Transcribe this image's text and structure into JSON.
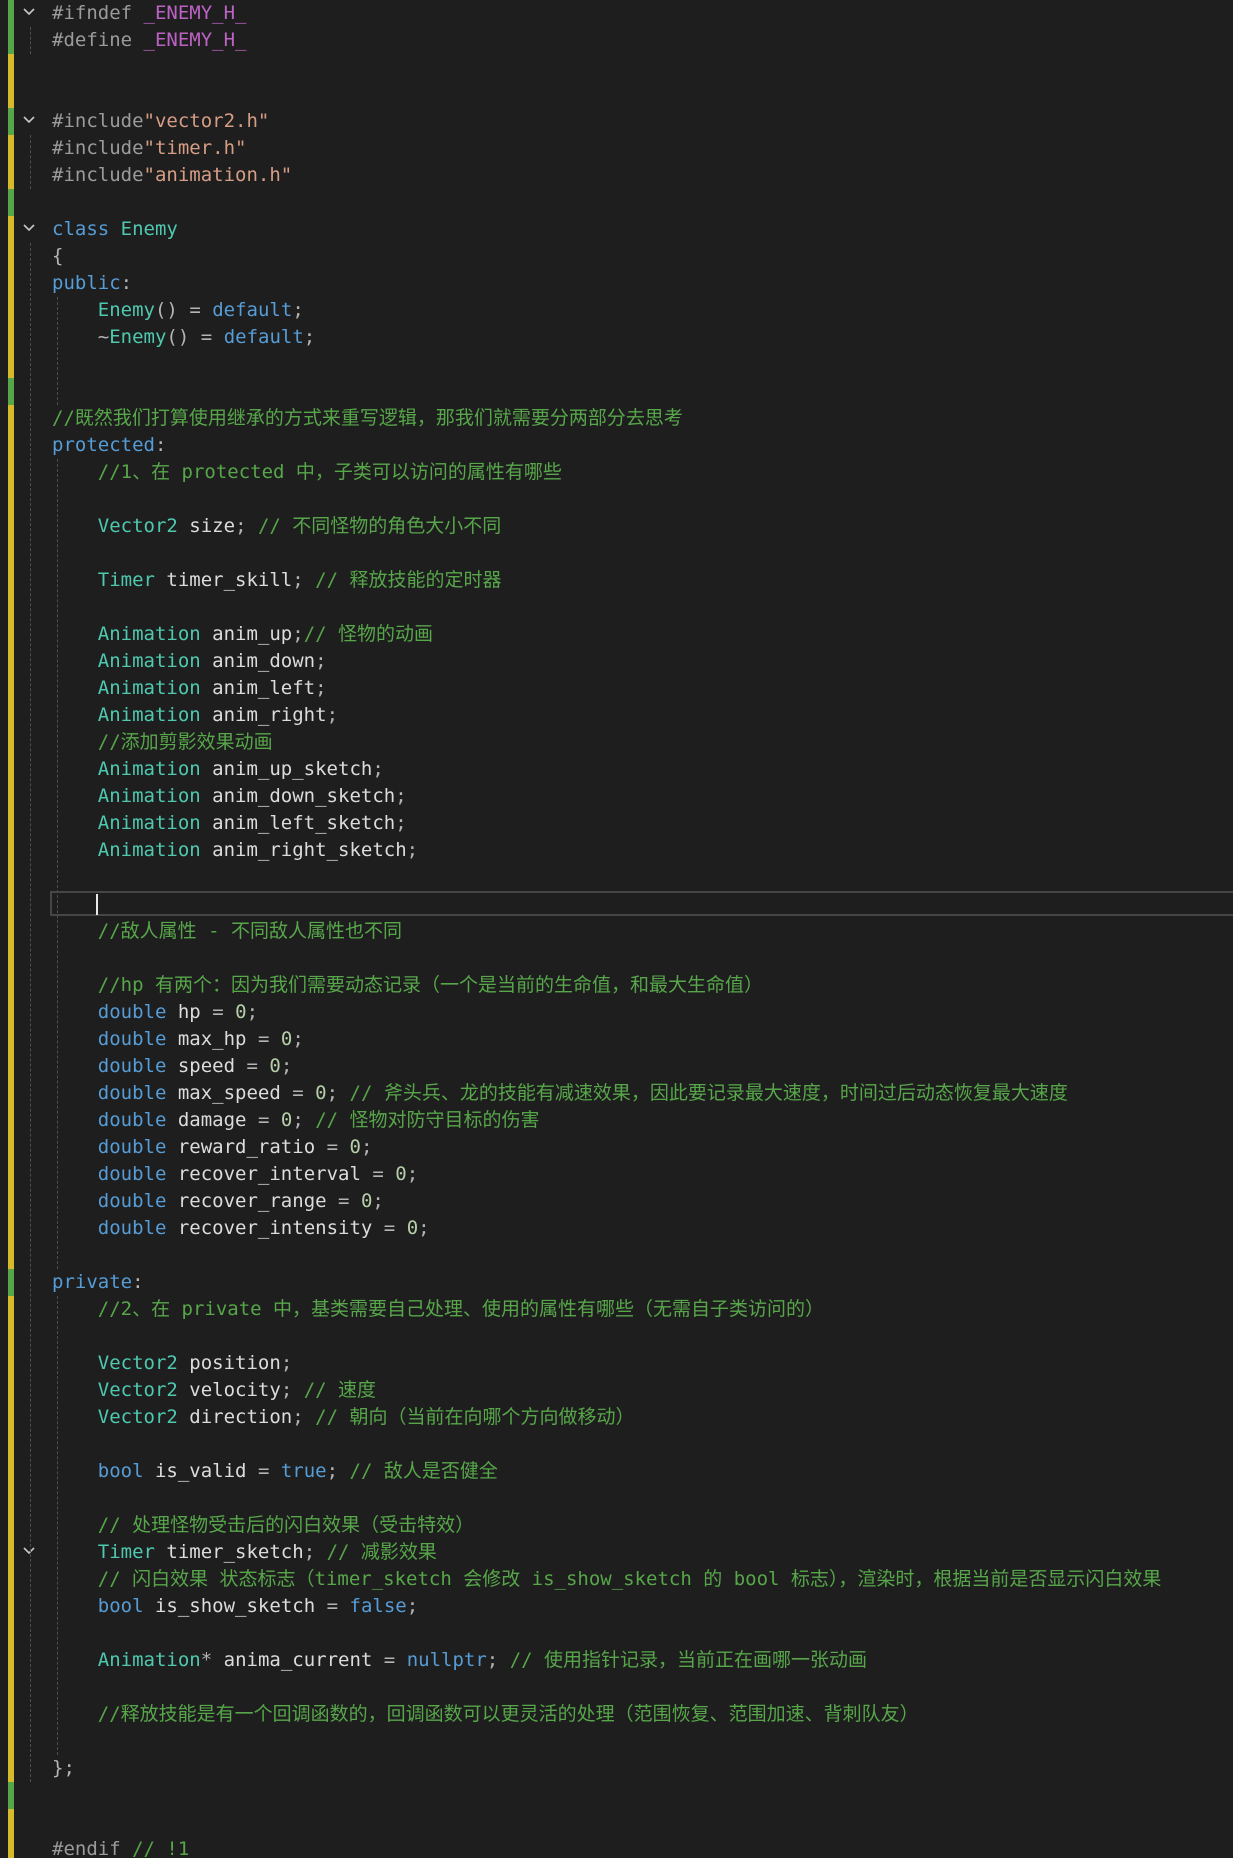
{
  "editor": {
    "language": "cpp",
    "lines": [
      "#ifndef _ENEMY_H_",
      "#define _ENEMY_H_",
      "",
      "",
      "#include\"vector2.h\"",
      "#include\"timer.h\"",
      "#include\"animation.h\"",
      "",
      "class Enemy",
      "{",
      "public:",
      "    Enemy() = default;",
      "    ~Enemy() = default;",
      "",
      "",
      "//既然我们打算使用继承的方式来重写逻辑，那我们就需要分两部分去思考",
      "protected:",
      "    //1、在 protected 中，子类可以访问的属性有哪些",
      "",
      "    Vector2 size; // 不同怪物的角色大小不同",
      "",
      "    Timer timer_skill; // 释放技能的定时器",
      "",
      "    Animation anim_up;// 怪物的动画",
      "    Animation anim_down;",
      "    Animation anim_left;",
      "    Animation anim_right;",
      "    //添加剪影效果动画",
      "    Animation anim_up_sketch;",
      "    Animation anim_down_sketch;",
      "    Animation anim_left_sketch;",
      "    Animation anim_right_sketch;",
      "",
      "    ",
      "    //敌人属性 - 不同敌人属性也不同",
      "",
      "    //hp 有两个：因为我们需要动态记录（一个是当前的生命值，和最大生命值）",
      "    double hp = 0;",
      "    double max_hp = 0;",
      "    double speed = 0;",
      "    double max_speed = 0; // 斧头兵、龙的技能有减速效果，因此要记录最大速度，时间过后动态恢复最大速度",
      "    double damage = 0; // 怪物对防守目标的伤害",
      "    double reward_ratio = 0;",
      "    double recover_interval = 0;",
      "    double recover_range = 0;",
      "    double recover_intensity = 0;",
      "",
      "private:",
      "    //2、在 private 中，基类需要自己处理、使用的属性有哪些（无需自子类访问的）",
      "",
      "    Vector2 position;",
      "    Vector2 velocity; // 速度",
      "    Vector2 direction; // 朝向（当前在向哪个方向做移动）",
      "",
      "    bool is_valid = true; // 敌人是否健全",
      "",
      "    // 处理怪物受击后的闪白效果（受击特效）",
      "    Timer timer_sketch; // 减影效果",
      "    // 闪白效果 状态标志（timer_sketch 会修改 is_show_sketch 的 bool 标志），渲染时，根据当前是否显示闪白效果",
      "    bool is_show_sketch = false;",
      "",
      "    Animation* anima_current = nullptr; // 使用指针记录，当前正在画哪一张动画",
      "",
      "    //释放技能是有一个回调函数的，回调函数可以更灵活的处理（范围恢复、范围加速、背刺队友）",
      "",
      "};",
      "",
      "",
      "#endif // !1"
    ]
  },
  "gutter": {
    "fold_icon": "chevron-down-icon",
    "added_color": "#57a64a",
    "modified_color": "#d7ba2b"
  },
  "colors": {
    "background": "#1e1e1e",
    "keyword": "#569cd6",
    "type": "#4ec9b0",
    "comment": "#57a64a",
    "string": "#d69d85",
    "preprocessor": "#9b9b9b",
    "macro": "#bd63c5",
    "number": "#b5cea8"
  }
}
